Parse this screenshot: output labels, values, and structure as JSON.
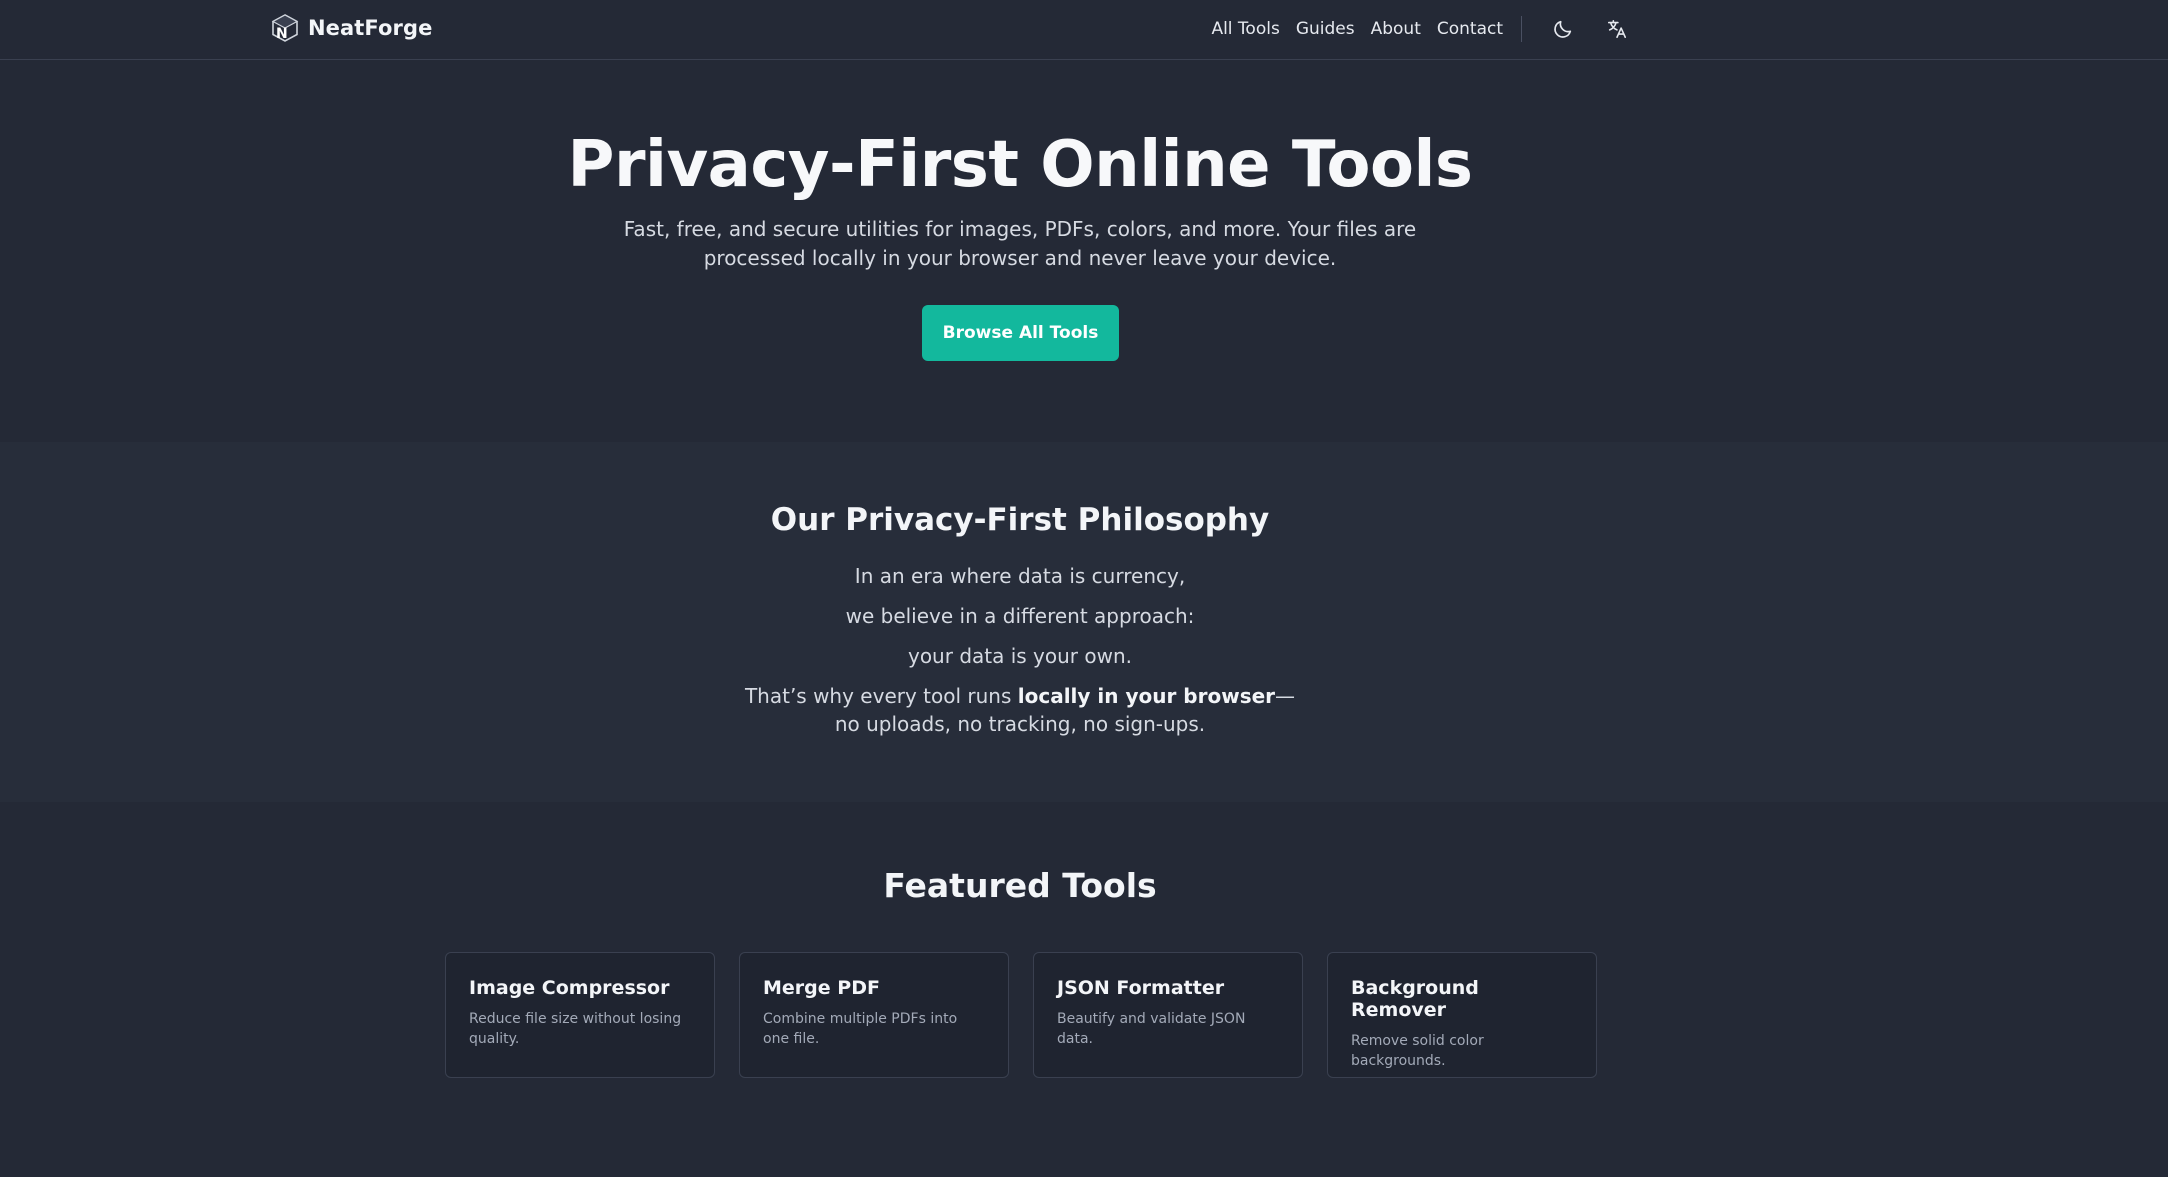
{
  "header": {
    "brand": "NeatForge",
    "nav": [
      "All Tools",
      "Guides",
      "About",
      "Contact"
    ],
    "theme_icon": "moon-icon",
    "language_icon": "translate-icon"
  },
  "hero": {
    "title": "Privacy-First Online Tools",
    "subtitle_line1": "Fast, free, and secure utilities for images, PDFs, colors, and more. Your files are",
    "subtitle_line2": "processed locally in your browser and never leave your device.",
    "cta": "Browse All Tools"
  },
  "philosophy": {
    "title": "Our Privacy-First Philosophy",
    "line1": "In an era where data is currency,",
    "line2": "we believe in a different approach:",
    "line3": "your data is your own.",
    "line4_prefix": "That’s why every tool runs ",
    "line4_bold": "locally in your browser",
    "line4_suffix": "—",
    "line5": "no uploads, no tracking, no sign-ups."
  },
  "featured": {
    "title": "Featured Tools",
    "tools": [
      {
        "name": "Image Compressor",
        "desc": "Reduce file size without losing quality."
      },
      {
        "name": "Merge PDF",
        "desc": "Combine multiple PDFs into one file."
      },
      {
        "name": "JSON Formatter",
        "desc": "Beautify and validate JSON data."
      },
      {
        "name": "Background Remover",
        "desc": "Remove solid color backgrounds."
      }
    ]
  },
  "colors": {
    "background": "#242936",
    "accent": "#13b89d",
    "card_background": "#1f2430"
  }
}
